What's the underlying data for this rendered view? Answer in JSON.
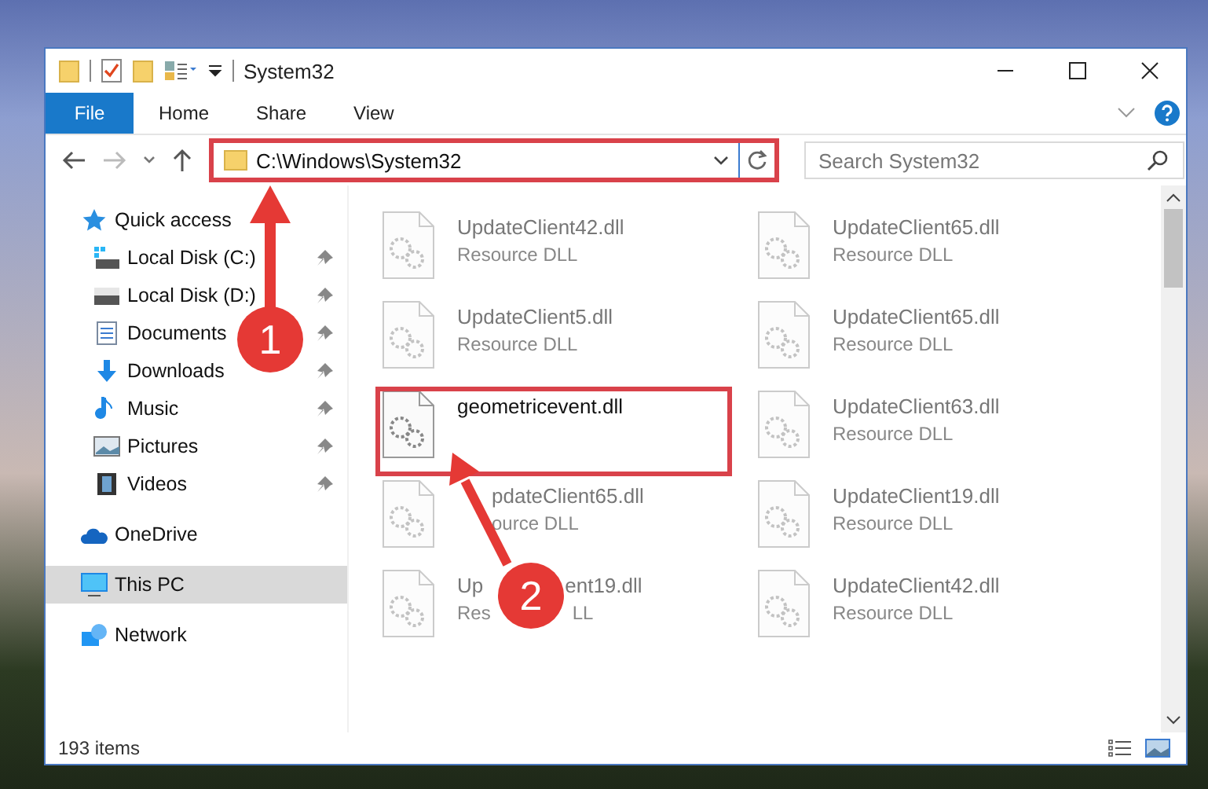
{
  "window": {
    "title": "System32"
  },
  "ribbon": {
    "tabs": [
      {
        "label": "File",
        "kind": "file"
      },
      {
        "label": "Home",
        "kind": "tab"
      },
      {
        "label": "Share",
        "kind": "tab"
      },
      {
        "label": "View",
        "kind": "tab"
      }
    ]
  },
  "address": {
    "path": "C:\\Windows\\System32",
    "highlighted": true
  },
  "search": {
    "placeholder": "Search System32"
  },
  "sidebar": {
    "items": [
      {
        "label": "Quick access",
        "kind": "star",
        "selected": false,
        "children": [
          {
            "label": "Local Disk (C:)",
            "kind": "windrive",
            "pinned": true,
            "selected": false
          },
          {
            "label": "Local Disk (D:)",
            "kind": "drive",
            "pinned": true,
            "selected": false
          },
          {
            "label": "Documents",
            "kind": "docs",
            "pinned": true,
            "selected": false
          },
          {
            "label": "Downloads",
            "kind": "download",
            "pinned": true,
            "selected": false
          },
          {
            "label": "Music",
            "kind": "music",
            "pinned": true,
            "selected": false
          },
          {
            "label": "Pictures",
            "kind": "pictures",
            "pinned": true,
            "selected": false
          },
          {
            "label": "Videos",
            "kind": "videos",
            "pinned": true,
            "selected": false
          }
        ]
      },
      {
        "label": "OneDrive",
        "kind": "cloud",
        "selected": false
      },
      {
        "label": "This PC",
        "kind": "pc",
        "selected": true
      },
      {
        "label": "Network",
        "kind": "network",
        "selected": false
      }
    ]
  },
  "files": [
    {
      "name_parts": [
        "UpdateClient42.dll"
      ],
      "type_parts": [
        "Resource DLL"
      ],
      "blurred": true,
      "highlighted": false
    },
    {
      "name_parts": [
        "UpdateClient65.dll"
      ],
      "type_parts": [
        "Resource DLL"
      ],
      "blurred": true,
      "highlighted": false
    },
    {
      "name_parts": [
        "UpdateClient5.dll"
      ],
      "type_parts": [
        "Resource DLL"
      ],
      "blurred": true,
      "highlighted": false
    },
    {
      "name_parts": [
        "UpdateClient65.dll"
      ],
      "type_parts": [
        "Resource DLL"
      ],
      "blurred": true,
      "highlighted": false
    },
    {
      "name_parts": [
        "geometricevent.dll"
      ],
      "blurred": false,
      "highlighted": true
    },
    {
      "name_parts": [
        "UpdateClient63.dll"
      ],
      "type_parts": [
        "Resource DLL"
      ],
      "blurred": true,
      "highlighted": false
    },
    {
      "name_parts": [
        "pdateClient65.dll"
      ],
      "type_parts": [
        "ource DLL"
      ],
      "lead_hidden": true,
      "blurred": true,
      "highlighted": false
    },
    {
      "name_parts": [
        "UpdateClient19.dll"
      ],
      "type_parts": [
        "Resource DLL"
      ],
      "blurred": true,
      "highlighted": false
    },
    {
      "name_parts": [
        "Up",
        "ent19.dll"
      ],
      "type_parts": [
        "Res",
        "LL"
      ],
      "blurred": true,
      "highlighted": false
    },
    {
      "name_parts": [
        "UpdateClient42.dll"
      ],
      "type_parts": [
        "Resource DLL"
      ],
      "blurred": true,
      "highlighted": false
    }
  ],
  "status_bar": {
    "count": "193 items"
  },
  "annotations": [
    {
      "number": "1"
    },
    {
      "number": "2"
    }
  ]
}
